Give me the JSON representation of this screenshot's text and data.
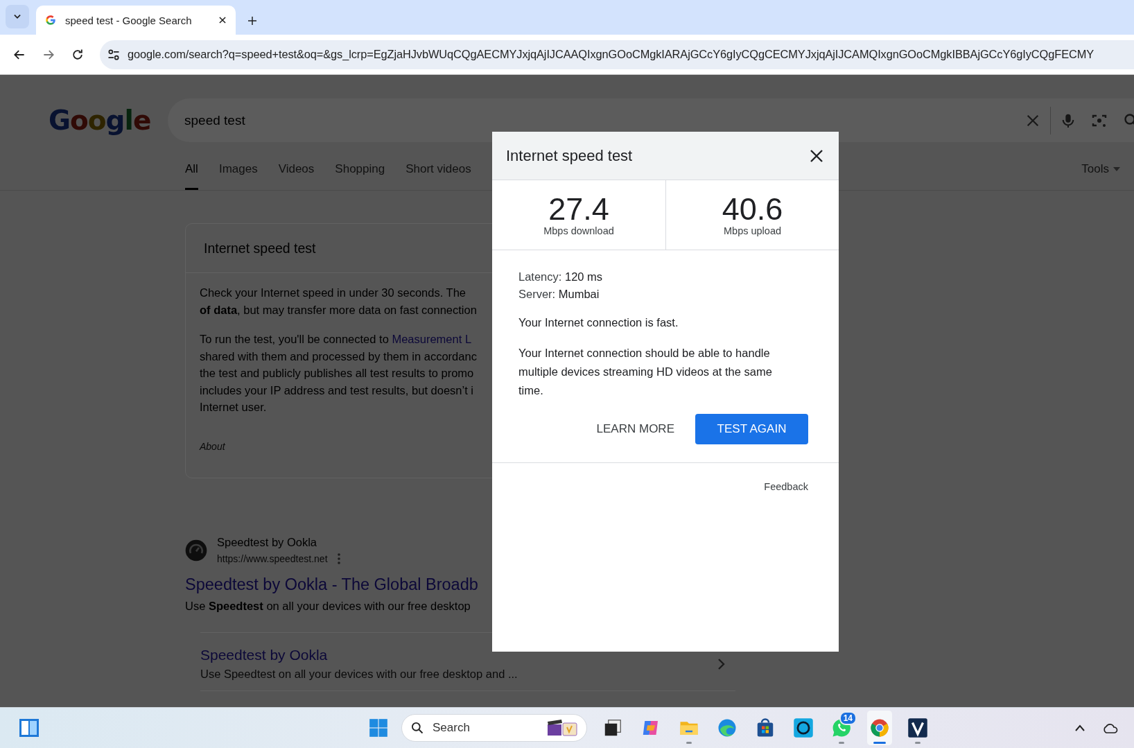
{
  "browser": {
    "tab_title": "speed test - Google Search",
    "address": "google.com/search?q=speed+test&oq=&gs_lcrp=EgZjaHJvbWUqCQgAECMYJxjqAjIJCAAQIxgnGOoCMgkIARAjGCcY6gIyCQgCECMYJxjqAjIJCAMQIxgnGOoCMgkIBBAjGCcY6gIyCQgFECMY"
  },
  "search": {
    "logo": "Google",
    "query": "speed test"
  },
  "tabs": [
    {
      "label": "All",
      "selected": true
    },
    {
      "label": "Images",
      "selected": false
    },
    {
      "label": "Videos",
      "selected": false
    },
    {
      "label": "Shopping",
      "selected": false
    },
    {
      "label": "Short videos",
      "selected": false
    }
  ],
  "tools": "Tools",
  "card": {
    "title": "Internet speed test",
    "paragraphs": [
      {
        "lines": [
          "Check your Internet speed in under 30 seconds. The",
          "**of data**, but may transfer more data on fast connection"
        ]
      },
      {
        "lines": [
          "To run the test, you'll be connected to",
          "shared with them and processed by them in accordanc",
          "the test and publicly publishes all test results to promo",
          "includes your IP address and test results, but doesn’t i",
          "Internet user."
        ],
        "link": "Measurement L"
      }
    ],
    "about": "About"
  },
  "result": {
    "site": "Speedtest by Ookla",
    "url": "https://www.speedtest.net",
    "title": "Speedtest by Ookla - The Global Broadb",
    "snippet": "Use **Speedtest** on all your devices with our free desktop",
    "sublink": {
      "title": "Speedtest by Ookla",
      "snippet": "Use Speedtest on all your devices with our free desktop and ..."
    }
  },
  "dialog": {
    "title": "Internet speed test",
    "stats": [
      {
        "value": "27.4",
        "label": "Mbps download"
      },
      {
        "value": "40.6",
        "label": "Mbps upload"
      }
    ],
    "details": [
      {
        "label": "Latency:",
        "value": "120 ms"
      },
      {
        "label": "Server:",
        "value": "Mumbai"
      }
    ],
    "verdict": "Your Internet connection is fast.",
    "description": "Your Internet connection should be able to handle multiple devices streaming HD videos at the same time.",
    "buttons": [
      {
        "label": "LEARN MORE",
        "kind": "text"
      },
      {
        "label": "TEST AGAIN",
        "kind": "primary"
      }
    ],
    "feedback": "Feedback"
  },
  "taskbar": {
    "search_placeholder": "Search",
    "apps": [
      {
        "kind": "taskview",
        "running": false,
        "selected": false
      },
      {
        "kind": "copilot",
        "running": false,
        "selected": false
      },
      {
        "kind": "folder",
        "running": true,
        "selected": false
      },
      {
        "kind": "edge",
        "running": false,
        "selected": false
      },
      {
        "kind": "store",
        "running": false,
        "selected": false
      },
      {
        "kind": "ring",
        "running": false,
        "selected": false
      },
      {
        "kind": "chat",
        "running": true,
        "selected": false,
        "badge": "14"
      },
      {
        "kind": "chrome",
        "running": true,
        "selected": true
      },
      {
        "kind": "vlogo",
        "running": true,
        "selected": false
      }
    ]
  }
}
